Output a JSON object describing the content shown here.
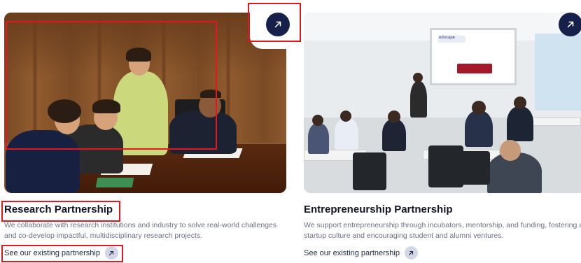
{
  "cards": [
    {
      "title": "Research Partnership",
      "description": "We collaborate with research institutions and industry to solve real-world challenges and co-develop impactful, multidisciplinary research projects.",
      "link_label": "See our existing partnership",
      "image_alt": "Partnership signing meeting",
      "icon": "arrow-up-right-icon"
    },
    {
      "title": "Entrepreneurship Partnership",
      "description": "We support entrepreneurship through incubators, mentorship, and funding, fostering a startup culture and encouraging student and alumni ventures.",
      "link_label": "See our existing partnership",
      "image_alt": "Entrepreneurship seminar in classroom",
      "screen_brand": "edocape",
      "icon": "arrow-up-right-icon"
    }
  ],
  "colors": {
    "arrow_button": "#17204a",
    "link_circle": "#d3d6e6",
    "annotation": "#e3171f",
    "title_text": "#101527",
    "description_text": "#6b7280"
  }
}
